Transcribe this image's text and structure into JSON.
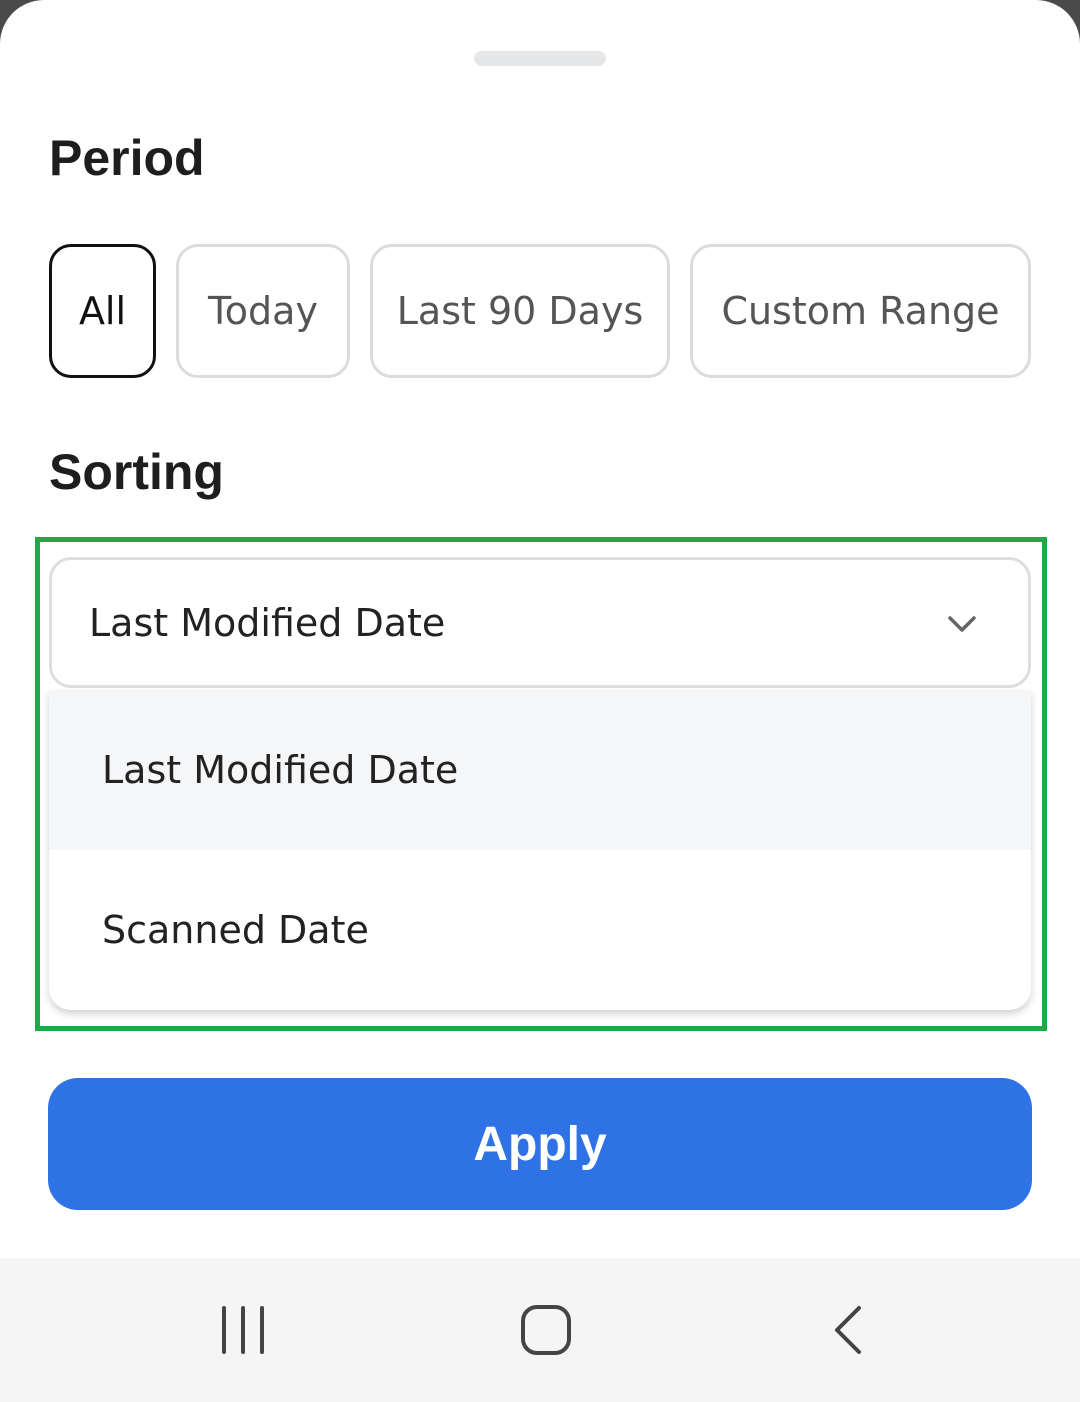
{
  "period": {
    "title": "Period",
    "options": [
      "All",
      "Today",
      "Last 90 Days",
      "Custom Range"
    ],
    "selected": "All"
  },
  "sorting": {
    "title": "Sorting",
    "selected_value": "Last Modified Date",
    "options": [
      "Last Modified Date",
      "Scanned Date"
    ]
  },
  "apply_label": "Apply",
  "colors": {
    "accent": "#2f72e6",
    "highlight_border": "#21a84a",
    "selected_chip_border": "#111111"
  },
  "icons": {
    "select": "chevron-down-icon",
    "nav": [
      "recent-apps-icon",
      "home-icon",
      "back-icon"
    ]
  }
}
